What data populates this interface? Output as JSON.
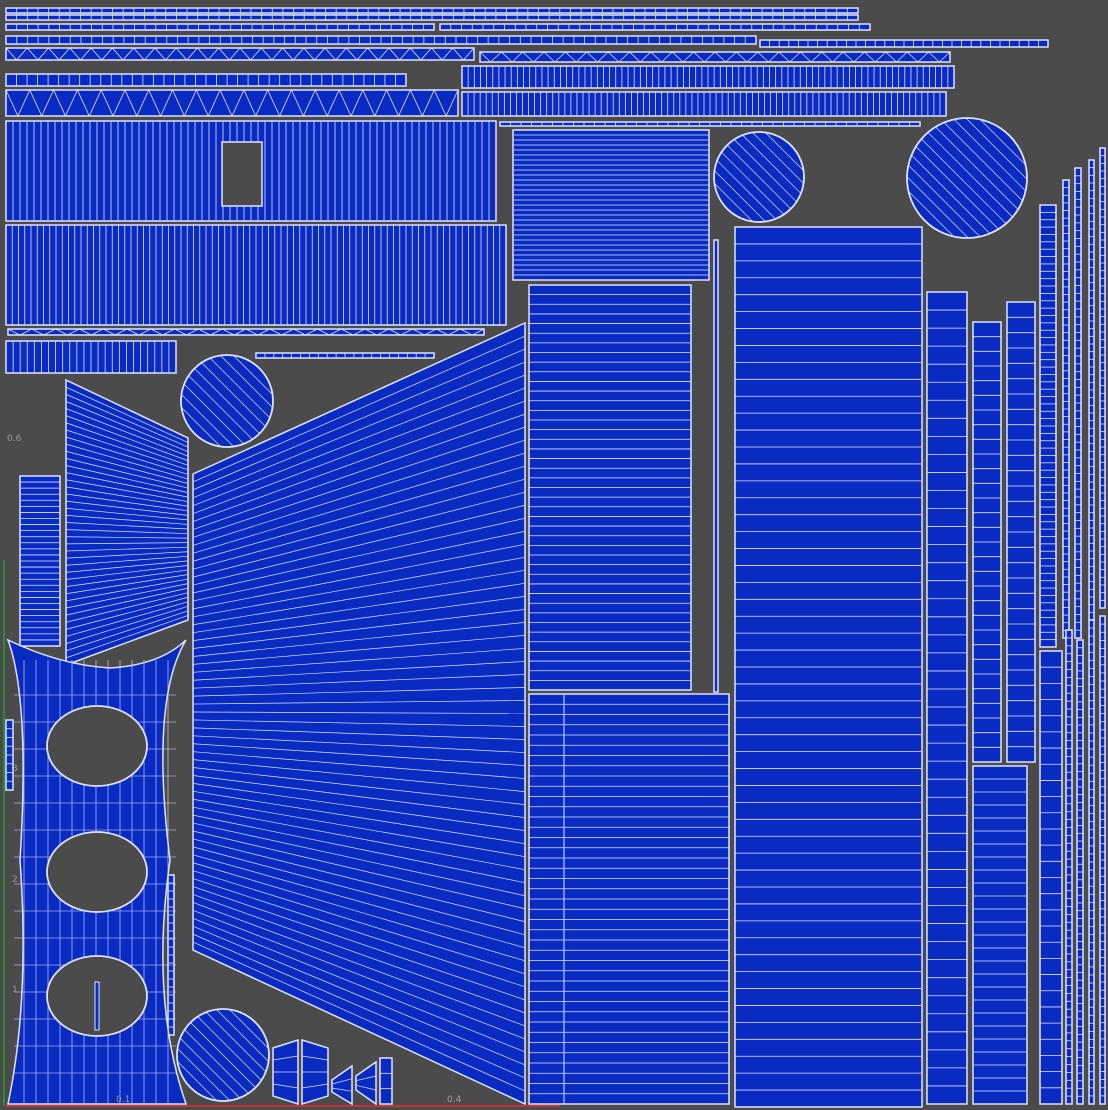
{
  "viewport": {
    "background": "#4b4b4b",
    "shell_fill": "#0a2bc2",
    "wire_color": "#dfe3ff",
    "axis_colors": {
      "u": "#c83232",
      "v": "#2e8b2e"
    }
  },
  "grid_labels": {
    "u": [
      "0.1",
      "0.4"
    ],
    "v": [
      "0.6",
      "3",
      "2",
      "1"
    ]
  }
}
